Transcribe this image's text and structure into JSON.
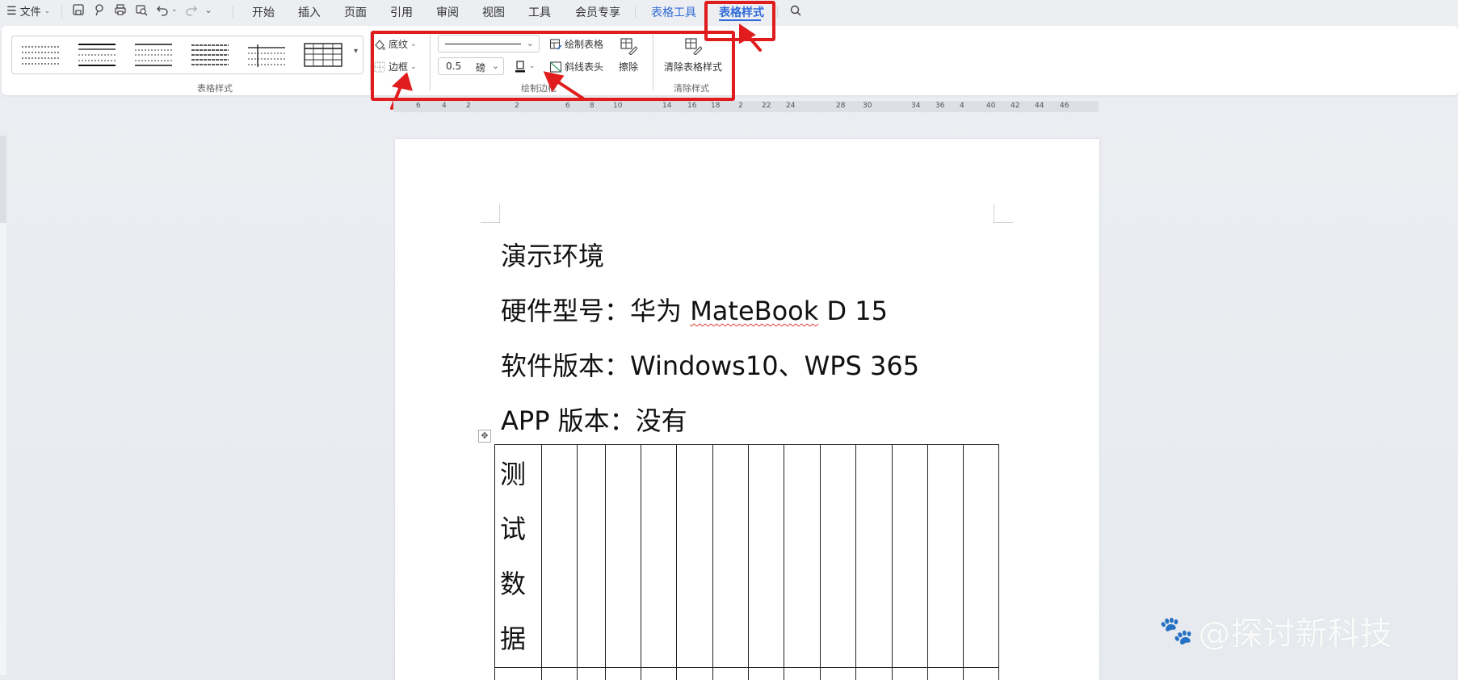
{
  "menubar": {
    "menu_icon": "hamburger-icon",
    "file_label": "文件",
    "tabs": [
      "开始",
      "插入",
      "页面",
      "引用",
      "审阅",
      "视图",
      "工具",
      "会员专享"
    ],
    "context_tabs": [
      "表格工具",
      "表格样式"
    ],
    "active_tab": "表格样式"
  },
  "ribbon": {
    "table_styles_group_label": "表格样式",
    "shading_label": "底纹",
    "border_label": "边框",
    "line_weight_value": "0.5",
    "line_weight_unit": "磅",
    "draw_table_label": "绘制表格",
    "diagonal_header_label": "斜线表头",
    "erase_label": "擦除",
    "clear_style_label": "清除表格样式",
    "draw_border_group_label": "绘制边框",
    "clear_style_group_label": "清除样式"
  },
  "ruler": {
    "ticks": [
      "6",
      "4",
      "2",
      "2",
      "6",
      "8",
      "10",
      "14",
      "16",
      "18",
      "2",
      "22",
      "24",
      "28",
      "30",
      "34",
      "36",
      "4",
      "40",
      "42",
      "44",
      "46"
    ]
  },
  "document": {
    "line1": "演示环境",
    "line2_prefix": "硬件型号：华为 ",
    "line2_mark": "MateBook",
    "line2_suffix": " D 15",
    "line3": "软件版本：Windows10、WPS 365",
    "line4": "APP 版本：没有",
    "table_first_cell_chars": [
      "测",
      "试",
      "数",
      "据"
    ]
  },
  "watermark": "@探讨新科技",
  "colors": {
    "accent": "#2f6bd8",
    "annotation_red": "#e01c1c",
    "page": "#ffffff"
  }
}
